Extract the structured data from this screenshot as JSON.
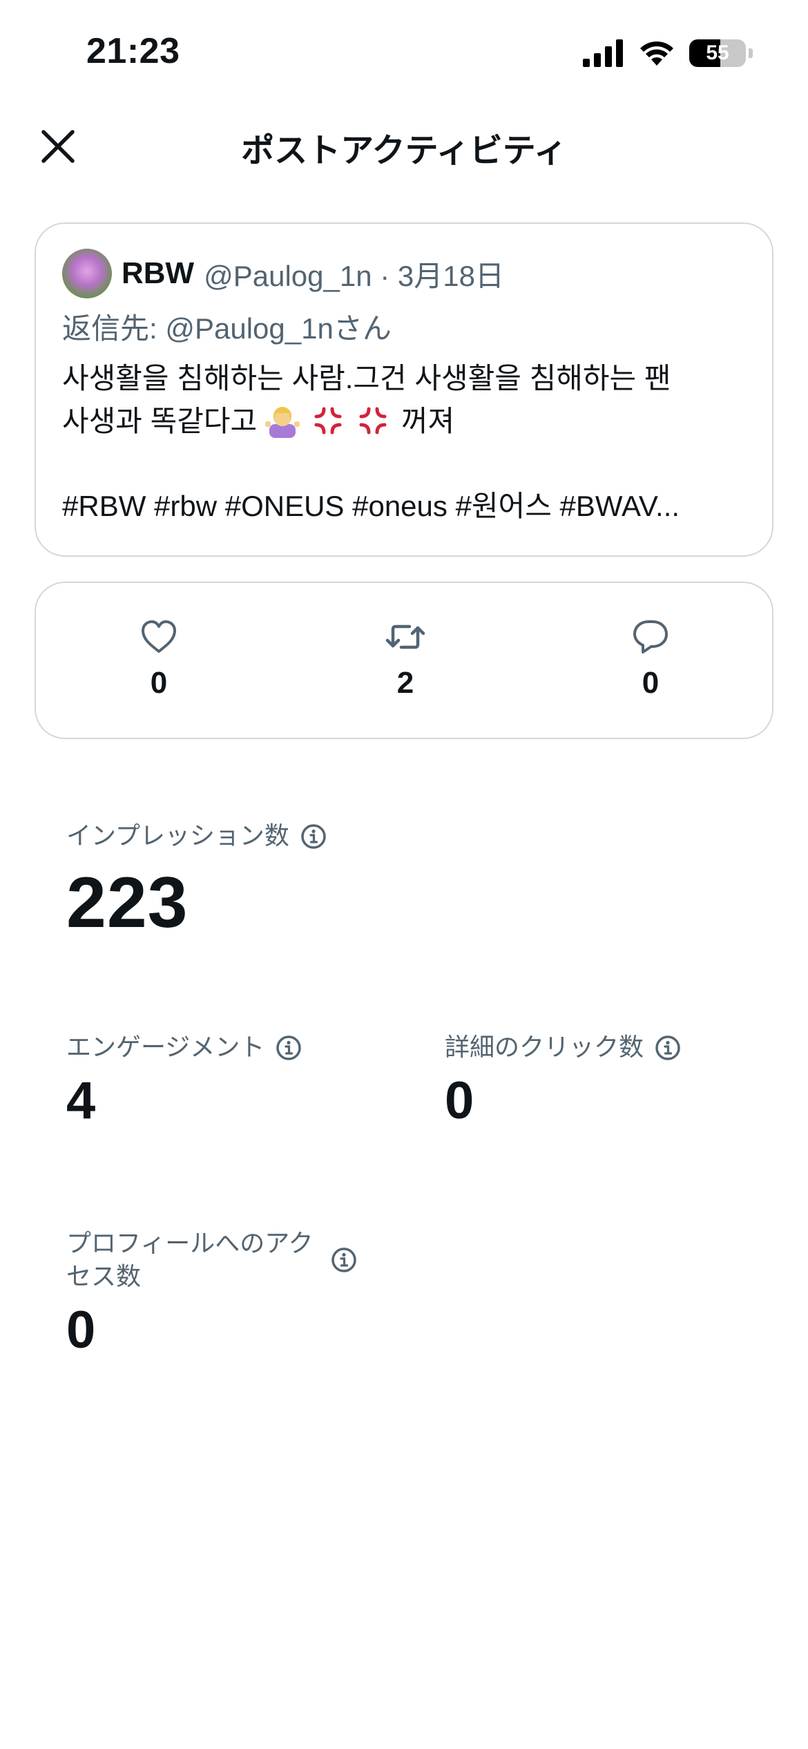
{
  "status_bar": {
    "time": "21:23",
    "battery": "55"
  },
  "header": {
    "title": "ポストアクティビティ"
  },
  "post": {
    "name": "RBW",
    "handle_date": "@Paulog_1n · 3月18日",
    "reply_to": "返信先: @Paulog_1nさん",
    "text_line1": "사생활을 침해하는 사람.그건 사생활을 침해하는 팬",
    "text_line2_pre": "사생과 똑같다고",
    "text_line2_post": "꺼져",
    "tags": "#RBW #rbw #ONEUS #oneus #원어스 #BWAV..."
  },
  "engagement_bar": {
    "likes": "0",
    "reposts": "2",
    "replies": "0"
  },
  "metrics": {
    "impressions": {
      "label": "インプレッション数",
      "value": "223"
    },
    "engagements": {
      "label": "エンゲージメント",
      "value": "4"
    },
    "detail_clicks": {
      "label": "詳細のクリック数",
      "value": "0"
    },
    "profile_visits": {
      "label_line1": "プロフィールへのアク",
      "label_line2": "セス数",
      "value": "0"
    }
  },
  "icons": {
    "close": "close-icon",
    "like": "heart-icon",
    "repost": "repost-icon",
    "reply": "reply-icon",
    "info": "info-icon"
  },
  "colors": {
    "text": "#0f1419",
    "secondary": "#536471",
    "border": "#cfd9de"
  }
}
